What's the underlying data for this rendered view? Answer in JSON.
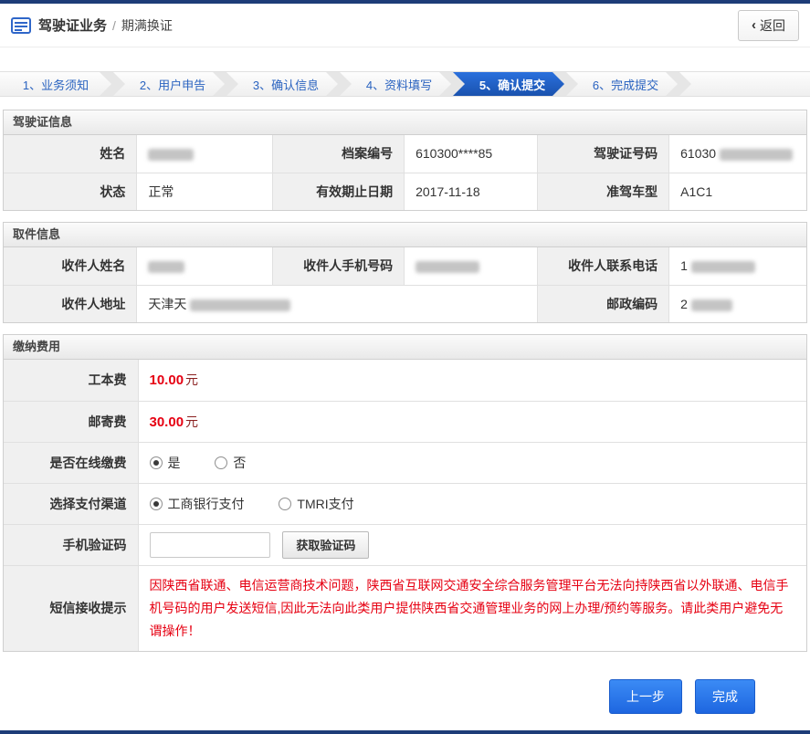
{
  "page": {
    "title_primary": "驾驶证业务",
    "title_separator": "/",
    "title_secondary": "期满换证",
    "back_chevron": "‹",
    "back_label": "返回"
  },
  "steps": [
    {
      "label": "1、业务须知",
      "active": false
    },
    {
      "label": "2、用户申告",
      "active": false
    },
    {
      "label": "3、确认信息",
      "active": false
    },
    {
      "label": "4、资料填写",
      "active": false
    },
    {
      "label": "5、确认提交",
      "active": true
    },
    {
      "label": "6、完成提交",
      "active": false
    }
  ],
  "license_section": {
    "title": "驾驶证信息",
    "name_label": "姓名",
    "name_value": "",
    "file_no_label": "档案编号",
    "file_no_value": "610300****85",
    "license_no_label": "驾驶证号码",
    "license_no_value": "61030",
    "status_label": "状态",
    "status_value": "正常",
    "expiry_label": "有效期止日期",
    "expiry_value": "2017-11-18",
    "vehicle_label": "准驾车型",
    "vehicle_value": "A1C1"
  },
  "pickup_section": {
    "title": "取件信息",
    "recipient_name_label": "收件人姓名",
    "recipient_name_value": "",
    "recipient_mobile_label": "收件人手机号码",
    "recipient_mobile_value": "",
    "recipient_phone_label": "收件人联系电话",
    "recipient_phone_value": "1",
    "recipient_address_label": "收件人地址",
    "recipient_address_value": "天津天",
    "postal_code_label": "邮政编码",
    "postal_code_value": "2"
  },
  "payment_section": {
    "title": "缴纳费用",
    "fee1_label": "工本费",
    "fee1_value": "10.00",
    "fee1_unit": "元",
    "fee2_label": "邮寄费",
    "fee2_value": "30.00",
    "fee2_unit": "元",
    "online_label": "是否在线缴费",
    "online_yes": "是",
    "online_no": "否",
    "channel_label": "选择支付渠道",
    "channel_icbc": "工商银行支付",
    "channel_tmri": "TMRI支付",
    "captcha_label": "手机验证码",
    "captcha_value": "",
    "captcha_button": "获取验证码",
    "sms_label": "短信接收提示",
    "sms_notice": "因陕西省联通、电信运营商技术问题，陕西省互联网交通安全综合服务管理平台无法向持陕西省以外联通、电信手机号码的用户发送短信,因此无法向此类用户提供陕西省交通管理业务的网上办理/预约等服务。请此类用户避免无谓操作！"
  },
  "footer": {
    "prev_button": "上一步",
    "finish_button": "完成"
  },
  "colors": {
    "navy_bar": "#1e3c78",
    "active_step_blue": "#1a52ae",
    "button_blue": "#1e66e0",
    "alert_red": "#e60012"
  }
}
